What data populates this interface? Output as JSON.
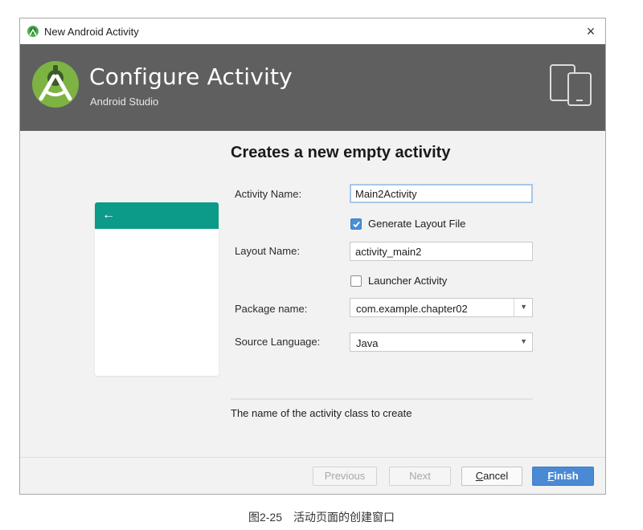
{
  "window": {
    "title": "New Android Activity",
    "close_glyph": "×"
  },
  "banner": {
    "title": "Configure Activity",
    "subtitle": "Android Studio",
    "background": "#5f5f5f"
  },
  "preview": {
    "toolbar_color": "#0c9b88",
    "back_glyph": "←"
  },
  "form": {
    "heading": "Creates a new empty activity",
    "activity_name_label": "Activity Name:",
    "activity_name_value": "Main2Activity",
    "generate_layout_label": "Generate Layout File",
    "generate_layout_checked": true,
    "layout_name_label": "Layout Name:",
    "layout_name_value": "activity_main2",
    "launcher_activity_label": "Launcher Activity",
    "launcher_activity_checked": false,
    "package_name_label": "Package name:",
    "package_name_value": "com.example.chapter02",
    "source_language_label": "Source Language:",
    "source_language_value": "Java"
  },
  "help": {
    "text": "The name of the activity class to create"
  },
  "buttons": {
    "previous": "Previous",
    "next": "Next",
    "cancel_mnemonic": "C",
    "cancel_rest": "ancel",
    "finish_mnemonic": "F",
    "finish_rest": "inish",
    "finish_color": "#4a8ad4"
  },
  "caption": "图2-25　活动页面的创建窗口"
}
